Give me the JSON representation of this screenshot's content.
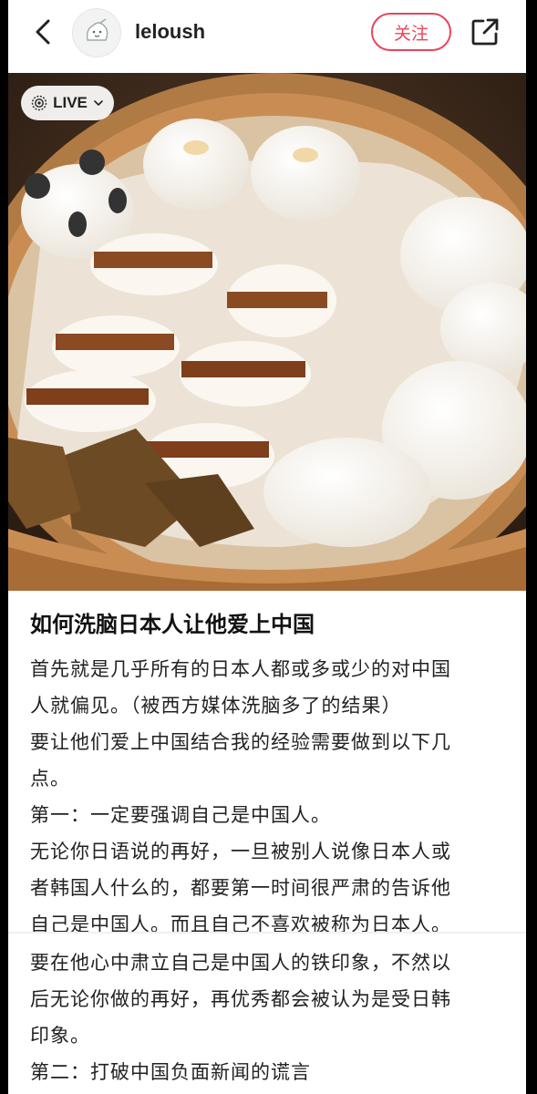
{
  "header": {
    "username": "leloush",
    "follow_label": "关注"
  },
  "photo": {
    "live_label": "LIVE",
    "alt": "steamed buns in a bamboo steamer"
  },
  "post": {
    "title": "如何洗脑日本人让他爱上中国",
    "lines": [
      "首先就是几乎所有的日本人都或多或少的对中国",
      "人就偏见。（被西方媒体洗脑多了的结果）",
      "要让他们爱上中国结合我的经验需要做到以下几",
      "点。",
      "第一：一定要强调自己是中国人。",
      "无论你日语说的再好，一旦被别人说像日本人或",
      "者韩国人什么的，都要第一时间很严肃的告诉他",
      "自己是中国人。而且自己不喜欢被称为日本人。"
    ],
    "lines2": [
      "要在他心中肃立自己是中国人的铁印象，不然以",
      "后无论你做的再好，再优秀都会被认为是受日韩",
      "印象。",
      "第二：打破中国负面新闻的谎言"
    ]
  },
  "colors": {
    "accent": "#e8455a",
    "background": "#ffffff",
    "text": "#222222"
  }
}
